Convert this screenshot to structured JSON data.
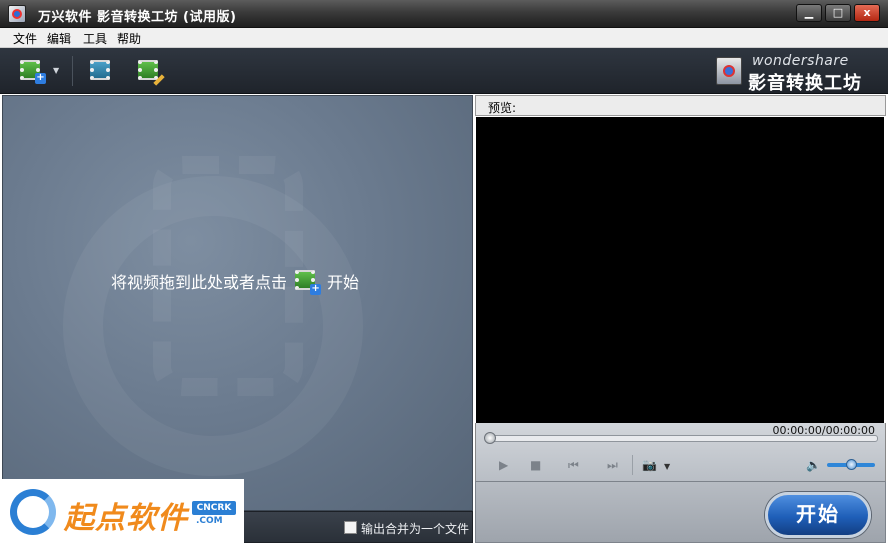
{
  "window": {
    "title": "万兴软件 影音转换工坊 (试用版)",
    "min_label": "▁",
    "max_label": "□",
    "close_label": "x"
  },
  "menu": {
    "items": [
      {
        "label": "文件"
      },
      {
        "label": "编辑"
      },
      {
        "label": "工具"
      },
      {
        "label": "帮助"
      }
    ]
  },
  "toolbar": {
    "add_icon": "add-video-icon",
    "merge_icon": "merge-video-icon",
    "edit_icon": "edit-video-icon",
    "brand_en": "wondershare",
    "brand_cn": "影音转换工坊"
  },
  "drop_zone": {
    "hint_text": "将视频拖到此处或者点击",
    "hint_suffix": "开始"
  },
  "left_bottom": {
    "merge_label": "输出合并为一个文件",
    "merge_checked": false
  },
  "watermark": {
    "site_name": "起点软件",
    "badge": "CNCRK",
    "domain": ".COM"
  },
  "preview": {
    "label": "预览:",
    "time": "00:00:00/00:00:00",
    "seek_progress": 0,
    "volume_level": 0.5
  },
  "controls": {
    "play_icon": "play-icon",
    "stop_icon": "stop-icon",
    "prev_icon": "previous-icon",
    "next_icon": "next-icon",
    "snapshot_icon": "camera-icon",
    "volume_icon": "speaker-icon"
  },
  "start": {
    "label": "开始"
  },
  "colors": {
    "start_button": "#1f5fb8",
    "volume_accent": "#2f86d8",
    "watermark_orange": "#f08a1c",
    "watermark_blue": "#2b7fd4"
  }
}
